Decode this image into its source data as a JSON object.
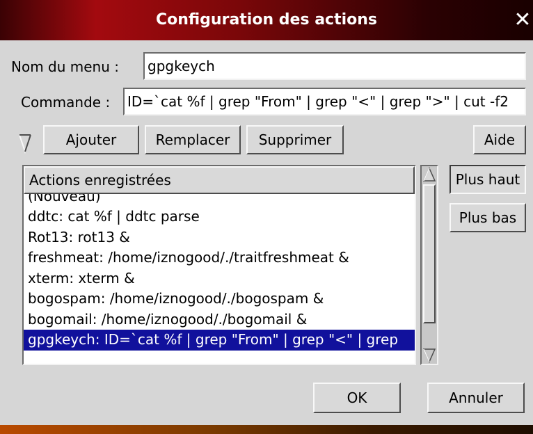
{
  "window": {
    "title": "Configuration des actions",
    "close_glyph": "✕"
  },
  "form": {
    "menu_name_label": "Nom du menu :",
    "menu_name_value": "gpgkeych",
    "command_label": "Commande :",
    "command_value": "ID=`cat %f | grep \"From\" | grep \"<\" | grep \">\" | cut -f2"
  },
  "toolbar": {
    "expand_icon": "chevron-down-icon",
    "add_label": "Ajouter",
    "replace_label": "Remplacer",
    "delete_label": "Supprimer",
    "help_label": "Aide"
  },
  "list": {
    "header": "Actions enregistrées",
    "items": [
      "(Nouveau)",
      "ddtc: cat %f | ddtc parse",
      "Rot13: rot13 &",
      "freshmeat: /home/iznogood/./traitfreshmeat &",
      "xterm: xterm &",
      "bogospam: /home/iznogood/./bogospam &",
      "bogomail: /home/iznogood/./bogomail &",
      "gpgkeych: ID=`cat %f | grep \"From\" | grep \"<\" | grep"
    ],
    "selected_index": 7
  },
  "side_buttons": {
    "up_label": "Plus haut",
    "down_label": "Plus bas"
  },
  "footer": {
    "ok_label": "OK",
    "cancel_label": "Annuler"
  },
  "colors": {
    "selection": "#11119c",
    "titlebar": "#a30a0f"
  }
}
